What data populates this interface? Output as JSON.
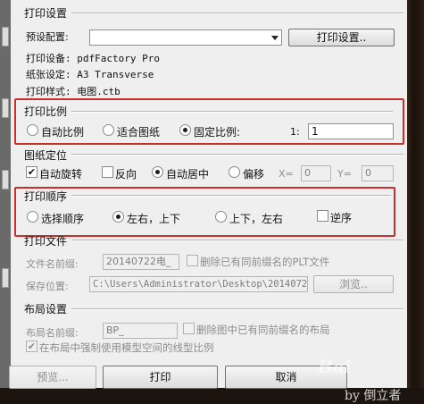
{
  "title": "打印设置",
  "preset": {
    "label": "预设配置:",
    "value": "",
    "button": "打印设置.."
  },
  "info": {
    "device": "打印设备: pdfFactory Pro",
    "paper": "纸张设定: A3 Transverse",
    "style": "打印样式: 电图.ctb"
  },
  "scale": {
    "title": "打印比例",
    "options": [
      "自动比例",
      "适合图纸",
      "固定比例:"
    ],
    "selected": "固定比例:",
    "ratio_left": "1:",
    "ratio_value": "1"
  },
  "position": {
    "title": "图纸定位",
    "auto_rotate": "自动旋转",
    "reverse": "反向",
    "auto_center": "自动居中",
    "offset": "偏移",
    "x_label": "X=",
    "x_value": "0",
    "y_label": "Y=",
    "y_value": "0"
  },
  "order": {
    "title": "打印顺序",
    "options": [
      "选择顺序",
      "左右，上下",
      "上下，左右"
    ],
    "selected": "左右，上下",
    "reverse": "逆序"
  },
  "file": {
    "title": "打印文件",
    "prefix_label": "文件名前缀:",
    "prefix_value": "20140722电_",
    "delete_same": "删除已有同前缀名的PLT文件",
    "save_label": "保存位置:",
    "save_value": "C:\\Users\\Administrator\\Desktop\\20140722电",
    "browse": "浏览.."
  },
  "layout": {
    "title": "布局设置",
    "name_label": "布局名前缀:",
    "name_value": "BP_",
    "delete_same": "删除图中已有同前缀名的布局",
    "force_linetype": "在布局中强制使用模型空间的线型比例"
  },
  "buttons": {
    "preview": "预览...",
    "print": "打印",
    "cancel": "取消"
  },
  "watermark": {
    "brand": "Bai",
    "by": "by 倒立者"
  },
  "colors": {
    "highlight": "#c9302c"
  }
}
